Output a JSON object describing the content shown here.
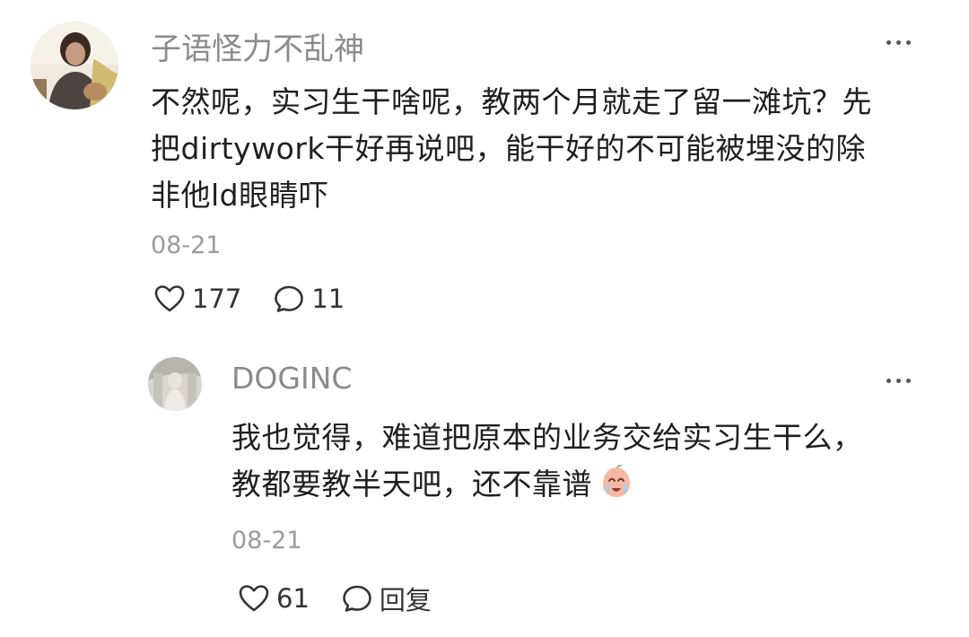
{
  "comments": [
    {
      "username": "子语怪力不乱神",
      "content": "不然呢，实习生干啥呢，教两个月就走了留一滩坑？先\n把dirtywork干好再说吧，能干好的不可能被埋没的除\n非他ld眼睛吓",
      "date": "08-21",
      "likes": "177",
      "replies": "11",
      "avatar_icon": "avatar-photo",
      "like_icon": "heart-outline-icon",
      "comment_icon": "speech-bubble-icon"
    },
    {
      "username": "DOGINC",
      "content": "我也觉得，难道把原本的业务交给实习生干么，\n教都要教半天吧，还不靠谱",
      "emoji": "crying-face-emoji",
      "date": "08-21",
      "likes": "61",
      "reply_label": "回复",
      "avatar_icon": "avatar-photo",
      "like_icon": "heart-outline-icon",
      "comment_icon": "speech-bubble-icon"
    }
  ],
  "colors": {
    "username": "#8a8a8a",
    "content": "#1f1f1f",
    "meta": "#9b9b9b",
    "icon": "#333333"
  }
}
